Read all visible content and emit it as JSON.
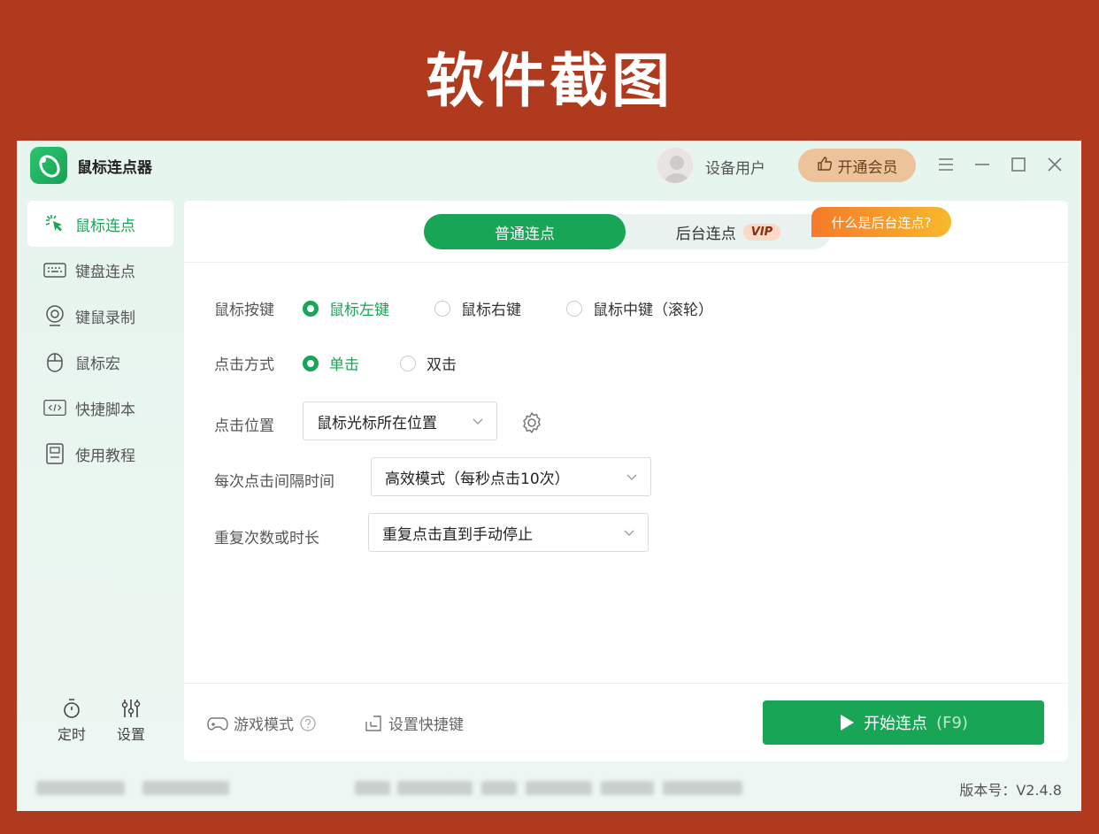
{
  "banner": {
    "title": "软件截图"
  },
  "app": {
    "title": "鼠标连点器",
    "user_name": "设备用户",
    "vip_button": "开通会员",
    "version": "版本号：V2.4.8"
  },
  "sidebar": {
    "items": [
      {
        "label": "鼠标连点",
        "icon": "cursor-click-icon",
        "active": true
      },
      {
        "label": "键盘连点",
        "icon": "keyboard-icon"
      },
      {
        "label": "键鼠录制",
        "icon": "record-icon"
      },
      {
        "label": "鼠标宏",
        "icon": "mouse-icon"
      },
      {
        "label": "快捷脚本",
        "icon": "code-icon"
      },
      {
        "label": "使用教程",
        "icon": "tutorial-icon"
      }
    ],
    "bottom": [
      {
        "label": "定时",
        "icon": "timer-icon"
      },
      {
        "label": "设置",
        "icon": "sliders-icon"
      }
    ]
  },
  "tabs": {
    "normal": "普通连点",
    "background": "后台连点",
    "vip_badge": "VIP",
    "what_is_background": "什么是后台连点?"
  },
  "form": {
    "mouse_button": {
      "label": "鼠标按键",
      "options": [
        "鼠标左键",
        "鼠标右键",
        "鼠标中键（滚轮）"
      ],
      "selected": "鼠标左键"
    },
    "click_mode": {
      "label": "点击方式",
      "options": [
        "单击",
        "双击"
      ],
      "selected": "单击"
    },
    "click_position": {
      "label": "点击位置",
      "value": "鼠标光标所在位置"
    },
    "interval": {
      "label": "每次点击间隔时间",
      "value": "高效模式（每秒点击10次）"
    },
    "repeat": {
      "label": "重复次数或时长",
      "value": "重复点击直到手动停止"
    }
  },
  "footer": {
    "game_mode": "游戏模式",
    "shortcut": "设置快捷键",
    "start_label": "开始连点",
    "start_key": "(F9)"
  },
  "colors": {
    "accent": "#19a556",
    "banner_bg": "#b03a1e",
    "vip_gold": "#ecc39a"
  }
}
